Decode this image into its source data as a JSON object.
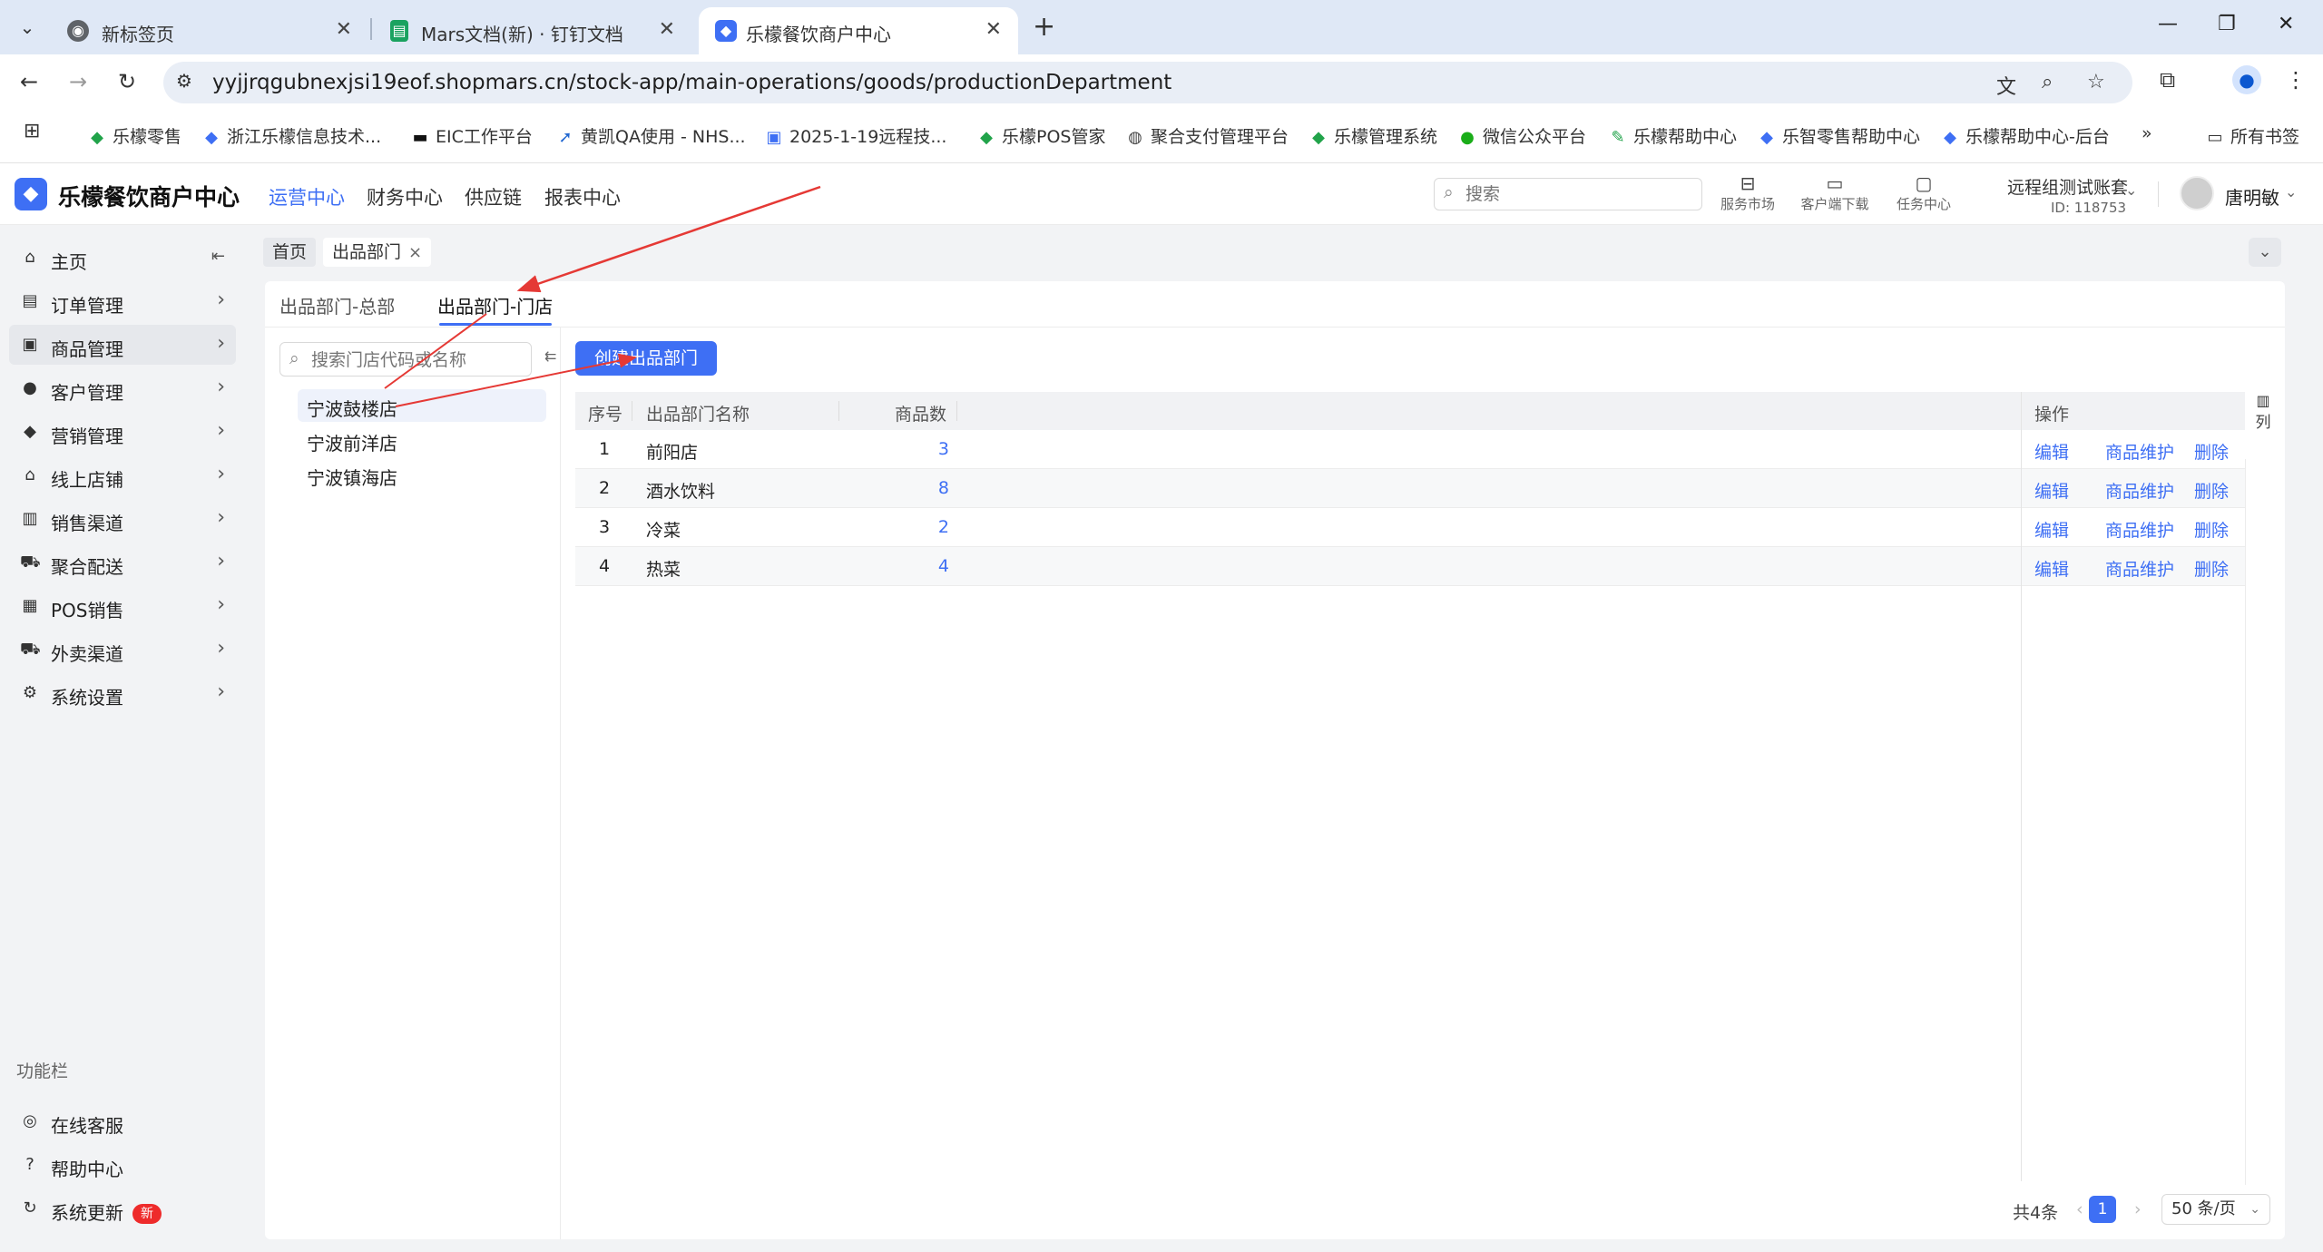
{
  "browser": {
    "tabs": [
      {
        "title": "新标签页",
        "favicon": "chrome-icon"
      },
      {
        "title": "Mars文档(新) · 钉钉文档",
        "favicon": "sheet-icon"
      },
      {
        "title": "乐檬餐饮商户中心",
        "favicon": "lemeng-icon"
      }
    ],
    "url": "yyjjrqgubnexjsi19eof.shopmars.cn/stock-app/main-operations/goods/productionDepartment",
    "bookmarks": [
      {
        "label": "乐檬零售",
        "icon": "leaf-icon",
        "color": "#21a34a"
      },
      {
        "label": "浙江乐檬信息技术...",
        "icon": "lemeng-icon",
        "color": "#3e6ff4"
      },
      {
        "label": "EIC工作平台",
        "icon": "eic-icon",
        "color": "#111111"
      },
      {
        "label": "黄凯QA使用 - NHS...",
        "icon": "jira-icon",
        "color": "#2268d1"
      },
      {
        "label": "2025-1-19远程技...",
        "icon": "doc-icon",
        "color": "#3e6ff4"
      },
      {
        "label": "乐檬POS管家",
        "icon": "leaf-icon",
        "color": "#21a34a"
      },
      {
        "label": "聚合支付管理平台",
        "icon": "globe-icon",
        "color": "#444444"
      },
      {
        "label": "乐檬管理系统",
        "icon": "leaf-icon",
        "color": "#21a34a"
      },
      {
        "label": "微信公众平台",
        "icon": "wechat-icon",
        "color": "#1aad19"
      },
      {
        "label": "乐檬帮助中心",
        "icon": "help-doc-icon",
        "color": "#21a34a"
      },
      {
        "label": "乐智零售帮助中心",
        "icon": "lemeng-icon",
        "color": "#3e6ff4"
      },
      {
        "label": "乐檬帮助中心-后台",
        "icon": "lemeng-icon",
        "color": "#3e6ff4"
      }
    ],
    "more_bookmarks": "»",
    "all_bookmarks": "所有书签"
  },
  "app": {
    "logo": "乐檬餐饮商户中心",
    "nav": [
      "运营中心",
      "财务中心",
      "供应链",
      "报表中心"
    ],
    "search_placeholder": "搜索",
    "tools": [
      {
        "label": "服务市场",
        "icon": "bag-icon"
      },
      {
        "label": "客户端下载",
        "icon": "folder-icon"
      },
      {
        "label": "任务中心",
        "icon": "clipboard-icon"
      }
    ],
    "account_name": "远程组测试账套",
    "account_id": "ID: 118753",
    "user_name": "唐明敏"
  },
  "sidebar": {
    "items": [
      {
        "label": "主页",
        "icon": "home-icon"
      },
      {
        "label": "订单管理",
        "icon": "order-icon"
      },
      {
        "label": "商品管理",
        "icon": "goods-icon"
      },
      {
        "label": "客户管理",
        "icon": "user-icon"
      },
      {
        "label": "营销管理",
        "icon": "tag-icon"
      },
      {
        "label": "线上店铺",
        "icon": "store-icon"
      },
      {
        "label": "销售渠道",
        "icon": "bank-icon"
      },
      {
        "label": "聚合配送",
        "icon": "truck-icon"
      },
      {
        "label": "POS销售",
        "icon": "pos-icon"
      },
      {
        "label": "外卖渠道",
        "icon": "delivery-icon"
      },
      {
        "label": "系统设置",
        "icon": "gear-icon"
      }
    ],
    "section_title": "功能栏",
    "footer_items": [
      {
        "label": "在线客服",
        "icon": "headset-icon"
      },
      {
        "label": "帮助中心",
        "icon": "question-icon"
      },
      {
        "label": "系统更新",
        "icon": "refresh-icon",
        "badge": "新"
      }
    ]
  },
  "page_tabs": [
    {
      "label": "首页"
    },
    {
      "label": "出品部门",
      "close": "×"
    }
  ],
  "sub_tabs": [
    "出品部门-总部",
    "出品部门-门店"
  ],
  "store_search_placeholder": "搜索门店代码或名称",
  "stores": [
    "宁波鼓楼店",
    "宁波前洋店",
    "宁波镇海店"
  ],
  "create_button": "创建出品部门",
  "table": {
    "headers": {
      "index": "序号",
      "name": "出品部门名称",
      "count": "商品数",
      "actions": "操作"
    },
    "rows": [
      {
        "index": "1",
        "name": "前阳店",
        "count": "3"
      },
      {
        "index": "2",
        "name": "酒水饮料",
        "count": "8"
      },
      {
        "index": "3",
        "name": "冷菜",
        "count": "2"
      },
      {
        "index": "4",
        "name": "热菜",
        "count": "4"
      }
    ],
    "actions": [
      "编辑",
      "商品维护",
      "删除"
    ],
    "column_setting": "列"
  },
  "pagination": {
    "total": "共4条",
    "current": "1",
    "page_size": "50 条/页"
  },
  "colors": {
    "accent": "#3e6ff4",
    "annotation_arrow": "#e53935"
  }
}
